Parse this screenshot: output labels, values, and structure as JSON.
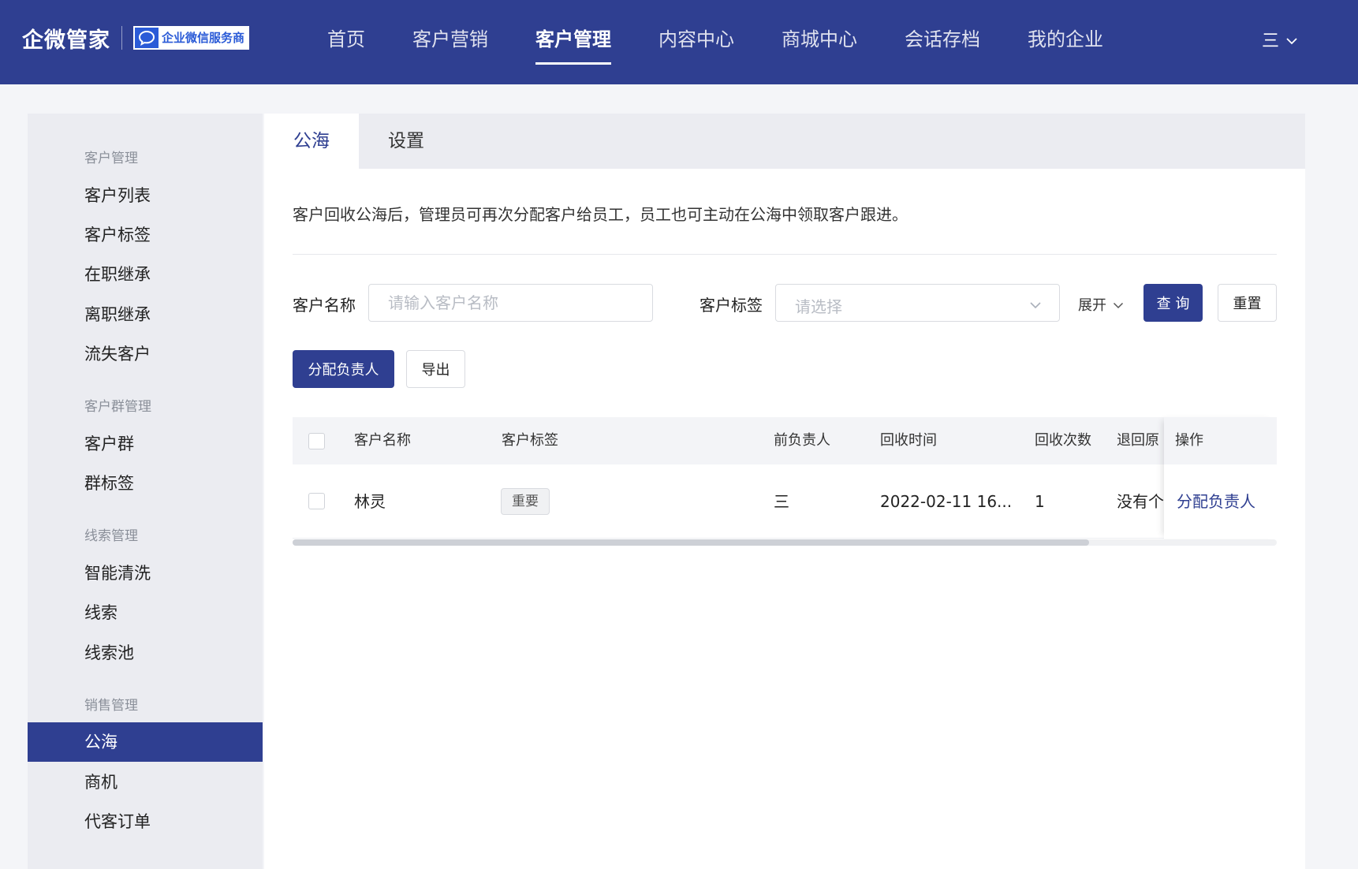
{
  "topbar": {
    "brand_name": "企微管家",
    "badge_text": "企业微信服务商",
    "nav": [
      {
        "label": "首页"
      },
      {
        "label": "客户营销"
      },
      {
        "label": "客户管理"
      },
      {
        "label": "内容中心"
      },
      {
        "label": "商城中心"
      },
      {
        "label": "会话存档"
      },
      {
        "label": "我的企业"
      }
    ],
    "active_nav": "客户管理",
    "menu_glyph": "三"
  },
  "sidebar": {
    "groups": [
      {
        "title": "客户管理",
        "items": [
          "客户列表",
          "客户标签",
          "在职继承",
          "离职继承",
          "流失客户"
        ]
      },
      {
        "title": "客户群管理",
        "items": [
          "客户群",
          "群标签"
        ]
      },
      {
        "title": "线索管理",
        "items": [
          "智能清洗",
          "线索",
          "线索池"
        ]
      },
      {
        "title": "销售管理",
        "items": [
          "公海",
          "商机",
          "代客订单"
        ]
      }
    ],
    "active_item": "公海"
  },
  "tabs": [
    {
      "label": "公海"
    },
    {
      "label": "设置"
    }
  ],
  "active_tab": "公海",
  "notice": "客户回收公海后，管理员可再次分配客户给员工，员工也可主动在公海中领取客户跟进。",
  "filters": {
    "name_label": "客户名称",
    "name_placeholder": "请输入客户名称",
    "name_value": "",
    "tag_label": "客户标签",
    "tag_placeholder": "请选择",
    "expand_label": "展开",
    "query_label": "查 询",
    "reset_label": "重置"
  },
  "actions": {
    "assign_label": "分配负责人",
    "export_label": "导出"
  },
  "table": {
    "headers": {
      "name": "客户名称",
      "tag": "客户标签",
      "prev_owner": "前负责人",
      "recycle_time": "回收时间",
      "recycle_count": "回收次数",
      "return_reason": "退回原",
      "action": "操作"
    },
    "rows": [
      {
        "name": "林灵",
        "tag": "重要",
        "prev_owner": "三",
        "recycle_time": "2022-02-11 16...",
        "recycle_count": "1",
        "return_reason": "没有个",
        "action": "分配负责人"
      }
    ]
  },
  "colors": {
    "primary": "#2f3f91",
    "sidebar_bg": "#ebecf1",
    "page_bg": "#f4f5f8"
  }
}
